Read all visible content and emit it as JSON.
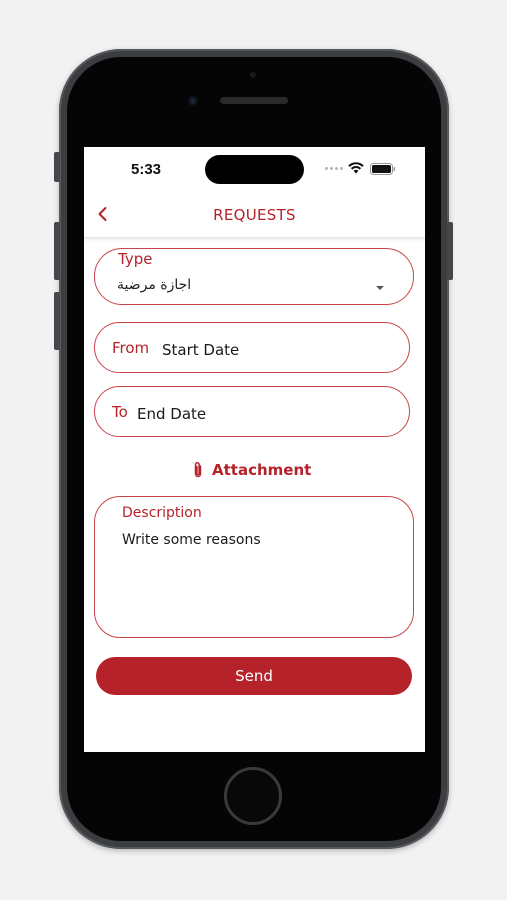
{
  "status_bar": {
    "time": "5:33"
  },
  "header": {
    "title": "REQUESTS",
    "back_icon": "chevron-left-icon"
  },
  "form": {
    "type": {
      "label": "Type",
      "value": "اجازة مرضية"
    },
    "from": {
      "label": "From",
      "placeholder": "Start Date"
    },
    "to": {
      "label": "To",
      "placeholder": "End Date"
    },
    "attachment": {
      "label": "Attachment",
      "icon": "paperclip-icon"
    },
    "description": {
      "label": "Description",
      "placeholder": "Write some reasons"
    },
    "send_label": "Send"
  },
  "colors": {
    "accent": "#b5222a",
    "background": "#f2f2f2"
  }
}
